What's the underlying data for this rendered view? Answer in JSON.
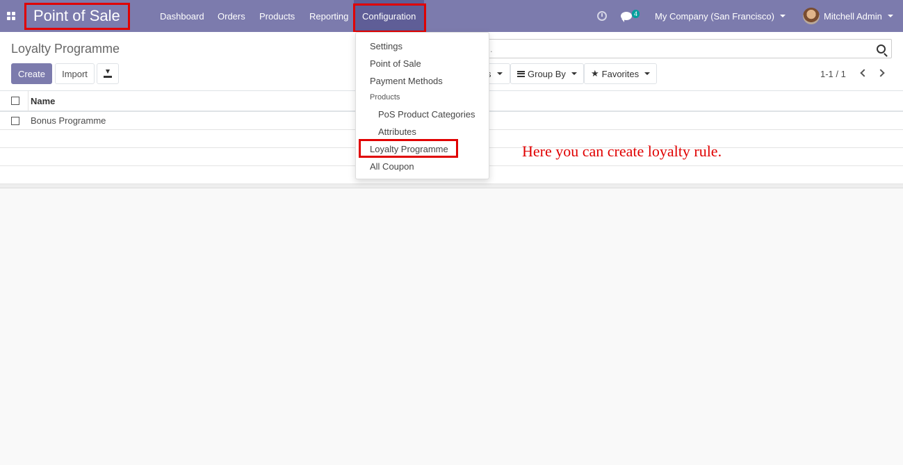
{
  "navbar": {
    "brand": "Point of Sale",
    "menu": [
      "Dashboard",
      "Orders",
      "Products",
      "Reporting",
      "Configuration"
    ],
    "chat_count": "4",
    "company": "My Company (San Francisco)",
    "user": "Mitchell Admin"
  },
  "control_panel": {
    "title": "Loyalty Programme",
    "create_label": "Create",
    "import_label": "Import",
    "search_partial": ".",
    "filters_partial": "s",
    "group_by_label": "Group By",
    "favorites_label": "Favorites",
    "pager": "1-1 / 1"
  },
  "list": {
    "header_name": "Name",
    "rows": [
      "Bonus Programme"
    ]
  },
  "dropdown": {
    "items": {
      "settings": "Settings",
      "pos": "Point of Sale",
      "payment": "Payment Methods",
      "products_header": "Products",
      "pos_categories": "PoS Product Categories",
      "attributes": "Attributes",
      "loyalty": "Loyalty Programme",
      "coupon": "All Coupon"
    }
  },
  "annotation": "Here you can create loyalty rule.",
  "colors": {
    "primary": "#7c7bad",
    "annotation": "#e00000"
  }
}
